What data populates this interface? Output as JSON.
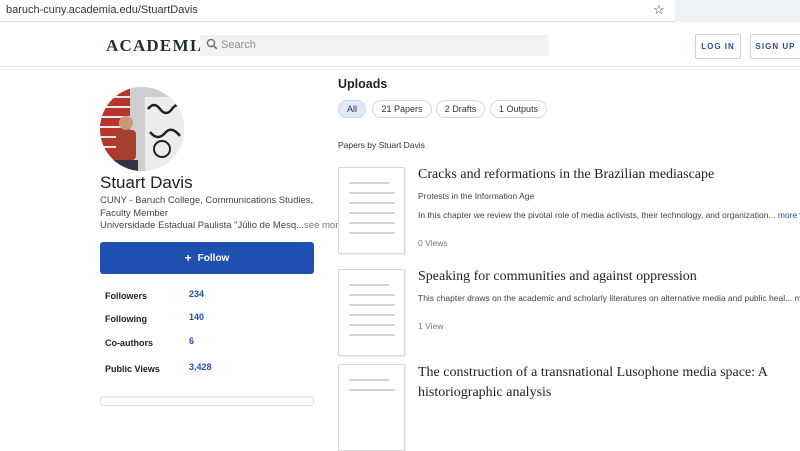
{
  "browser": {
    "url": "baruch-cuny.academia.edu/StuartDavis"
  },
  "header": {
    "logo": "ACADEMIA",
    "search_placeholder": "Search",
    "login_label": "LOG IN",
    "signup_label": "SIGN UP"
  },
  "profile": {
    "name": "Stuart Davis",
    "affiliation": "CUNY - Baruch College, Communications Studies, Faculty Member",
    "affiliation2": "Universidade Estadual Paulista \"Júlio de Mesq...",
    "see_more": "see more",
    "follow_label": "Follow",
    "stats": [
      {
        "label": "Followers",
        "value": "234"
      },
      {
        "label": "Following",
        "value": "140"
      },
      {
        "label": "Co-authors",
        "value": "6"
      },
      {
        "label": "Public Views",
        "value": "3,428"
      }
    ]
  },
  "uploads": {
    "title": "Uploads",
    "tabs": [
      {
        "label": "All",
        "active": true
      },
      {
        "label": "21 Papers",
        "active": false
      },
      {
        "label": "2 Drafts",
        "active": false
      },
      {
        "label": "1 Outputs",
        "active": false
      }
    ],
    "section_label": "Papers by Stuart Davis",
    "papers": [
      {
        "title": "Cracks and reformations in the Brazilian mediascape",
        "subtitle": "Protests in the Information Age",
        "description": "In this chapter we review the pivotal role of media activists, their technology, and organization...",
        "more": "more",
        "views": "0 Views"
      },
      {
        "title": "Speaking for communities and against oppression",
        "subtitle": "",
        "description": "This chapter draws on the academic and scholarly literatures on alternative media and public heal...",
        "more": "more",
        "views": "1 View"
      },
      {
        "title_line1": "The construction of a transnational Lusophone media space: A",
        "title_line2": "historiographic analysis"
      }
    ]
  },
  "colors": {
    "accent": "#1f4fb0",
    "tab_active": "#e0e9f7"
  }
}
